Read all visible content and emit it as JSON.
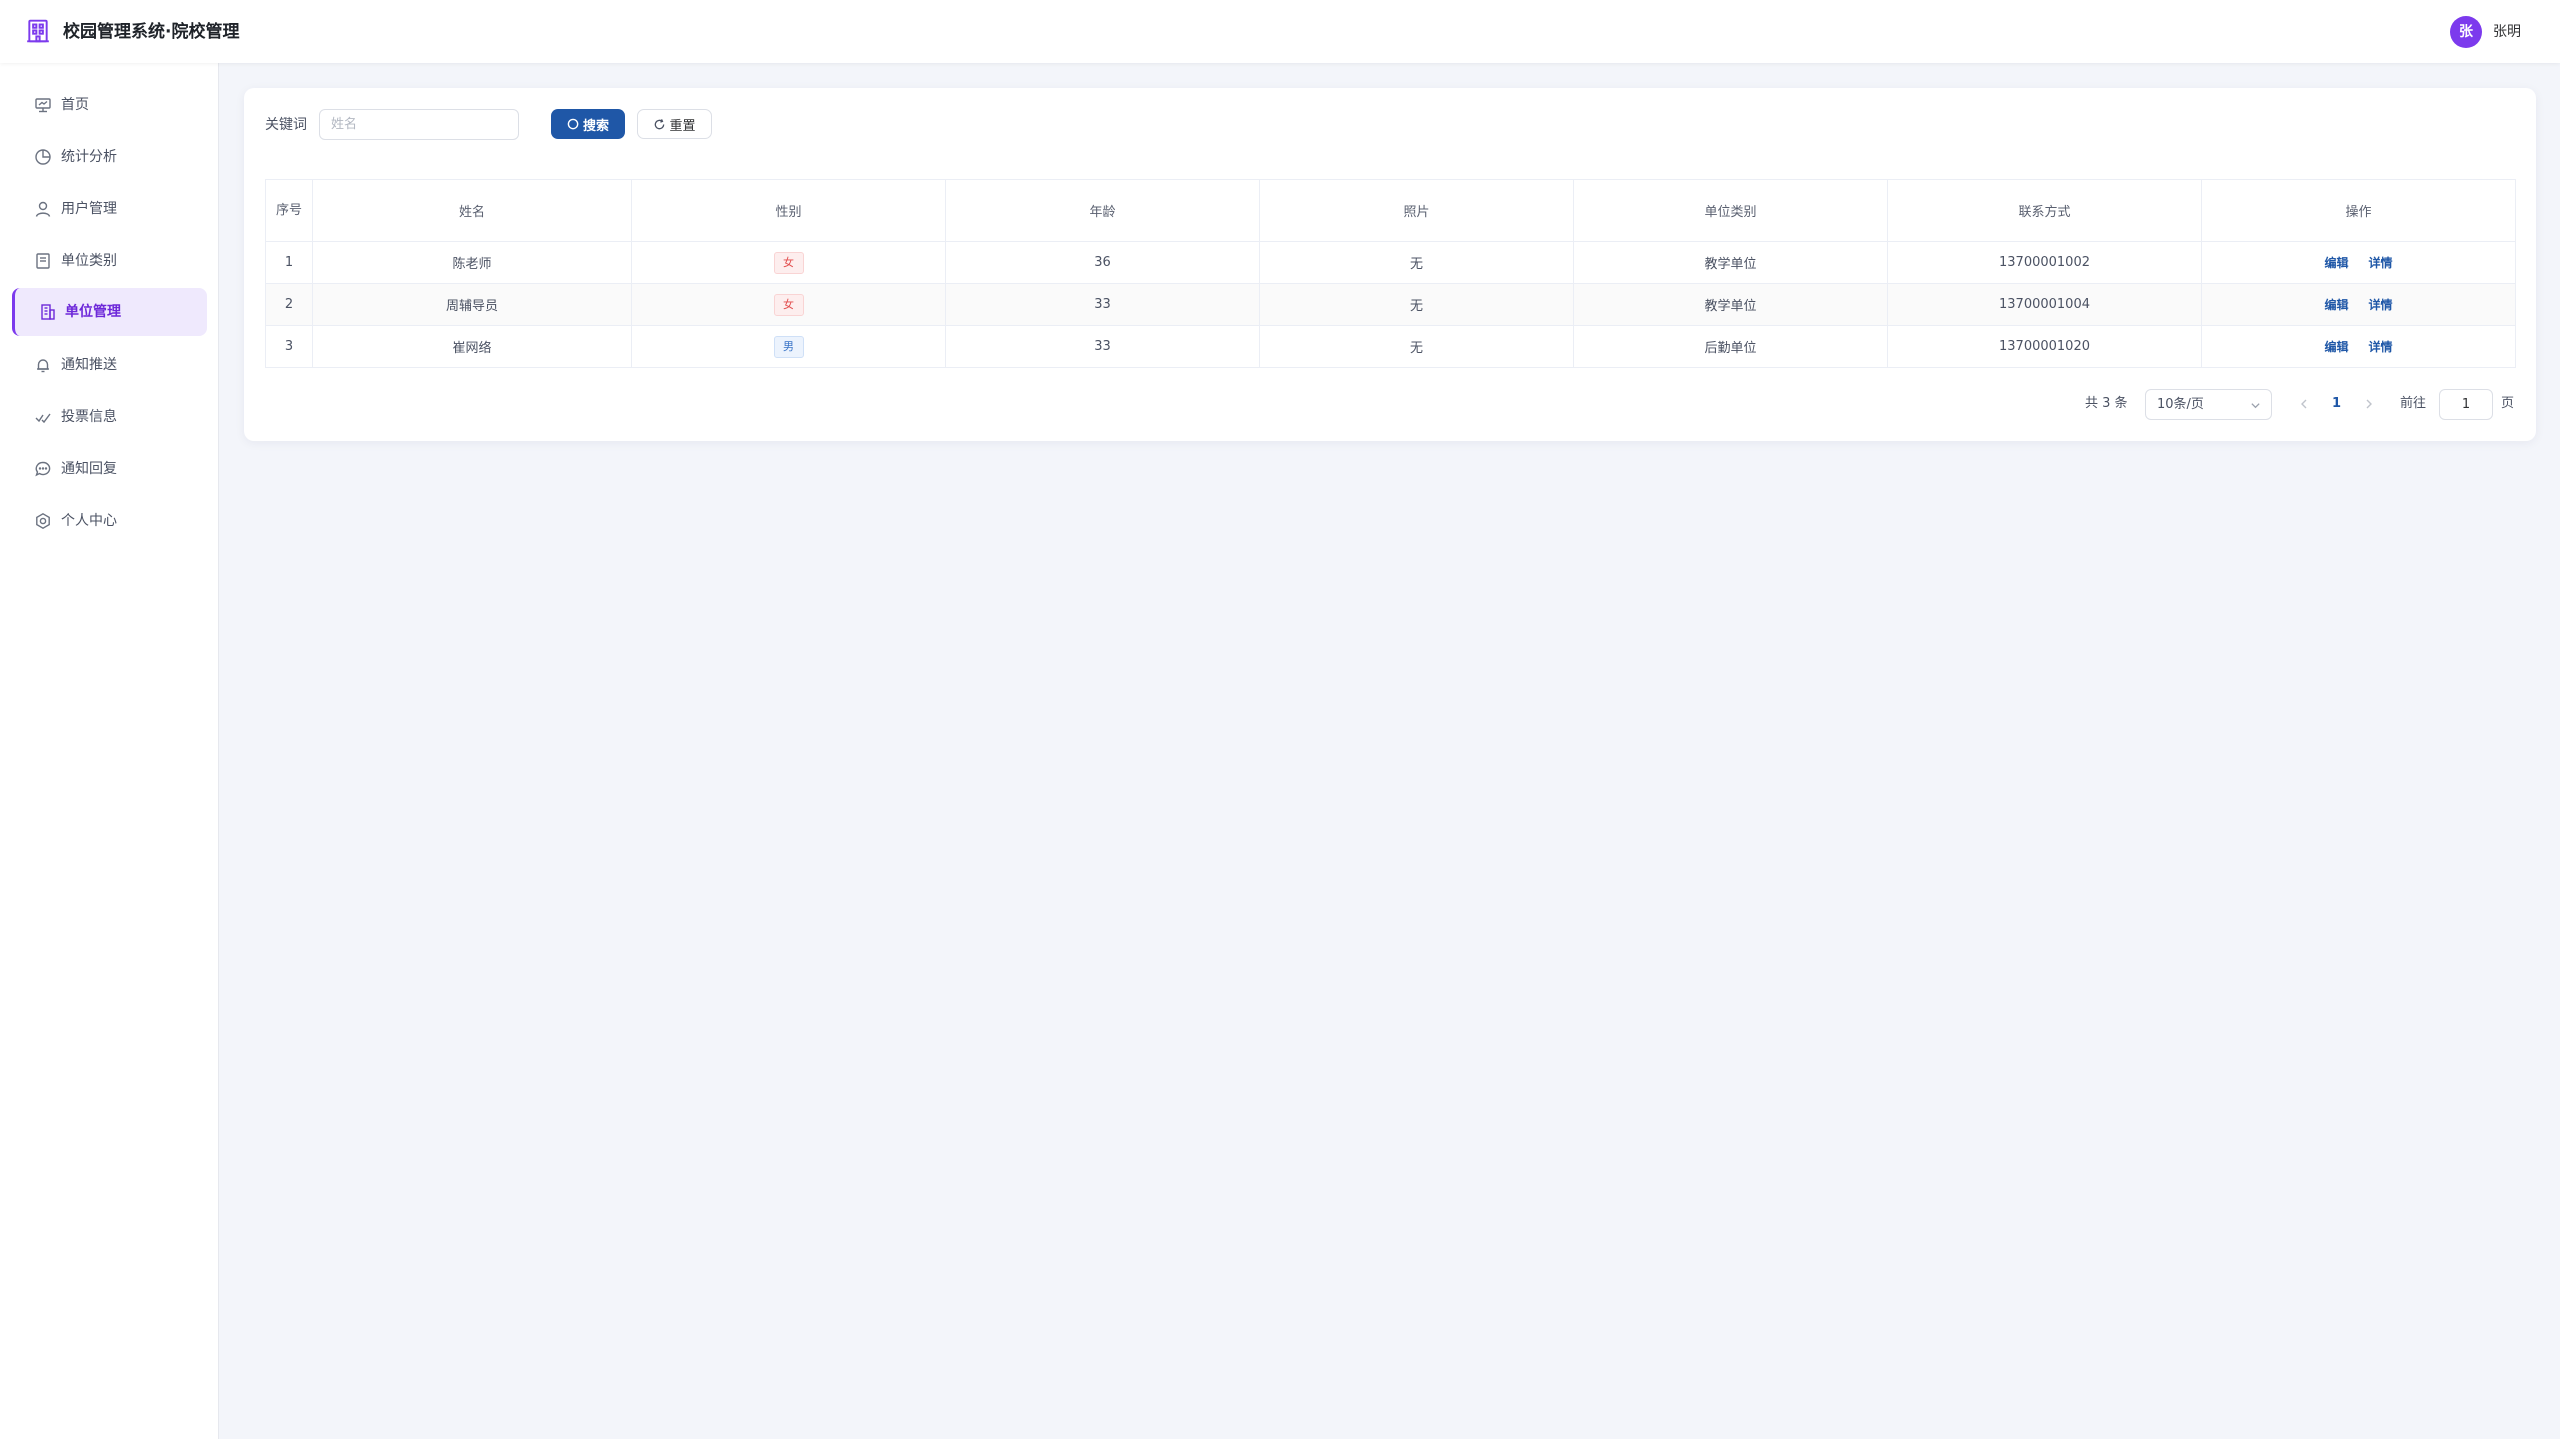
{
  "app": {
    "title": "校园管理系统·院校管理"
  },
  "user": {
    "avatar_text": "张",
    "name": "张明"
  },
  "sidebar": {
    "items": [
      {
        "label": "首页",
        "icon": "dashboard-icon",
        "active": false
      },
      {
        "label": "统计分析",
        "icon": "pie-chart-icon",
        "active": false
      },
      {
        "label": "用户管理",
        "icon": "user-icon",
        "active": false
      },
      {
        "label": "单位类别",
        "icon": "document-icon",
        "active": false
      },
      {
        "label": "单位管理",
        "icon": "building-icon",
        "active": true
      },
      {
        "label": "通知推送",
        "icon": "bell-icon",
        "active": false
      },
      {
        "label": "投票信息",
        "icon": "vote-icon",
        "active": false
      },
      {
        "label": "通知回复",
        "icon": "chat-icon",
        "active": false
      },
      {
        "label": "个人中心",
        "icon": "gear-icon",
        "active": false
      }
    ]
  },
  "search": {
    "keyword_label": "关键词",
    "placeholder": "姓名",
    "value": "",
    "search_label": "搜索",
    "reset_label": "重置"
  },
  "table": {
    "columns": [
      "序号",
      "姓名",
      "性别",
      "年龄",
      "照片",
      "单位类别",
      "联系方式",
      "操作"
    ],
    "rows": [
      {
        "index": "1",
        "name": "陈老师",
        "gender": "女",
        "age": "36",
        "photo": "无",
        "category": "教学单位",
        "contact": "13700001002"
      },
      {
        "index": "2",
        "name": "周辅导员",
        "gender": "女",
        "age": "33",
        "photo": "无",
        "category": "教学单位",
        "contact": "13700001004"
      },
      {
        "index": "3",
        "name": "崔网络",
        "gender": "男",
        "age": "33",
        "photo": "无",
        "category": "后勤单位",
        "contact": "13700001020"
      }
    ],
    "actions": {
      "edit": "编辑",
      "detail": "详情"
    }
  },
  "pagination": {
    "total_text": "共 3 条",
    "page_size": "10条/页",
    "current_page": "1",
    "goto_label": "前往",
    "goto_value": "1",
    "page_unit": "页"
  },
  "colors": {
    "accent": "#7c3aed",
    "primary_button": "#1f57a7",
    "female_tag": "#e24d4d",
    "male_tag": "#3a74c7",
    "background": "#f3f5fa"
  }
}
